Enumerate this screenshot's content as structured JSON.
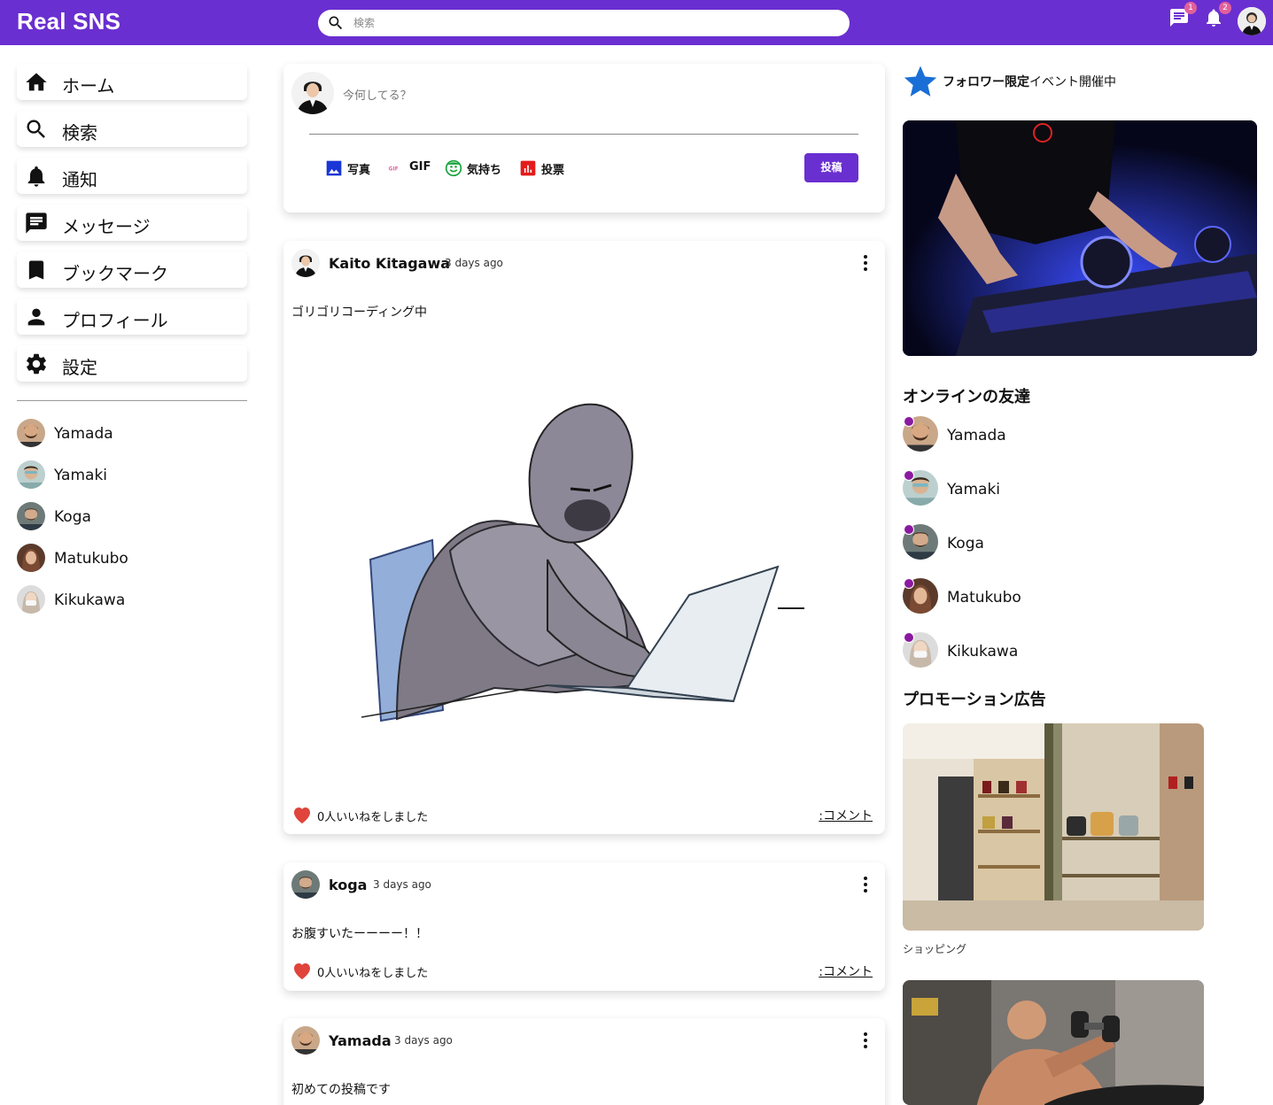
{
  "header": {
    "brand": "Real SNS",
    "search_placeholder": "検索",
    "message_badge": "1",
    "notification_badge": "2"
  },
  "sidebar": {
    "items": [
      {
        "label": "ホーム",
        "icon": "home-icon"
      },
      {
        "label": "検索",
        "icon": "search-icon"
      },
      {
        "label": "通知",
        "icon": "bell-icon"
      },
      {
        "label": "メッセージ",
        "icon": "chat-icon"
      },
      {
        "label": "ブックマーク",
        "icon": "bookmark-icon"
      },
      {
        "label": "プロフィール",
        "icon": "person-icon"
      },
      {
        "label": "設定",
        "icon": "gear-icon"
      }
    ],
    "friends": [
      "Yamada",
      "Yamaki",
      "Koga",
      "Matukubo",
      "Kikukawa"
    ]
  },
  "composer": {
    "placeholder": "今何してる？",
    "options": [
      {
        "label": "写真",
        "icon": "photo-icon"
      },
      {
        "label": "GIF",
        "icon": "gif-icon"
      },
      {
        "label": "気持ち",
        "icon": "mood-icon"
      },
      {
        "label": "投票",
        "icon": "poll-icon"
      }
    ],
    "submit": "投稿"
  },
  "posts": [
    {
      "author": "Kaito Kitagawa",
      "time": "3 days ago",
      "text": "ゴリゴリコーディング中",
      "likes": "0人いいねをしました",
      "comment": ":コメント"
    },
    {
      "author": "koga",
      "time": "3 days ago",
      "text": "お腹すいたーーーー！！",
      "likes": "0人いいねをしました",
      "comment": ":コメント"
    },
    {
      "author": "Yamada",
      "time": "3 days ago",
      "text": "初めての投稿です"
    }
  ],
  "rightbar": {
    "event_bold": "フォロワー限定",
    "event_rest": "イベント開催中",
    "online_title": "オンラインの友達",
    "online": [
      "Yamada",
      "Yamaki",
      "Koga",
      "Matukubo",
      "Kikukawa"
    ],
    "promo_title": "プロモーション広告",
    "promo1_label": "ショッピング"
  },
  "colors": {
    "brand": "#6a2fd0",
    "like": "#e0443a",
    "online_dot": "#8a1aa0",
    "badge": "#e0609c",
    "star": "#1a6fd6"
  }
}
